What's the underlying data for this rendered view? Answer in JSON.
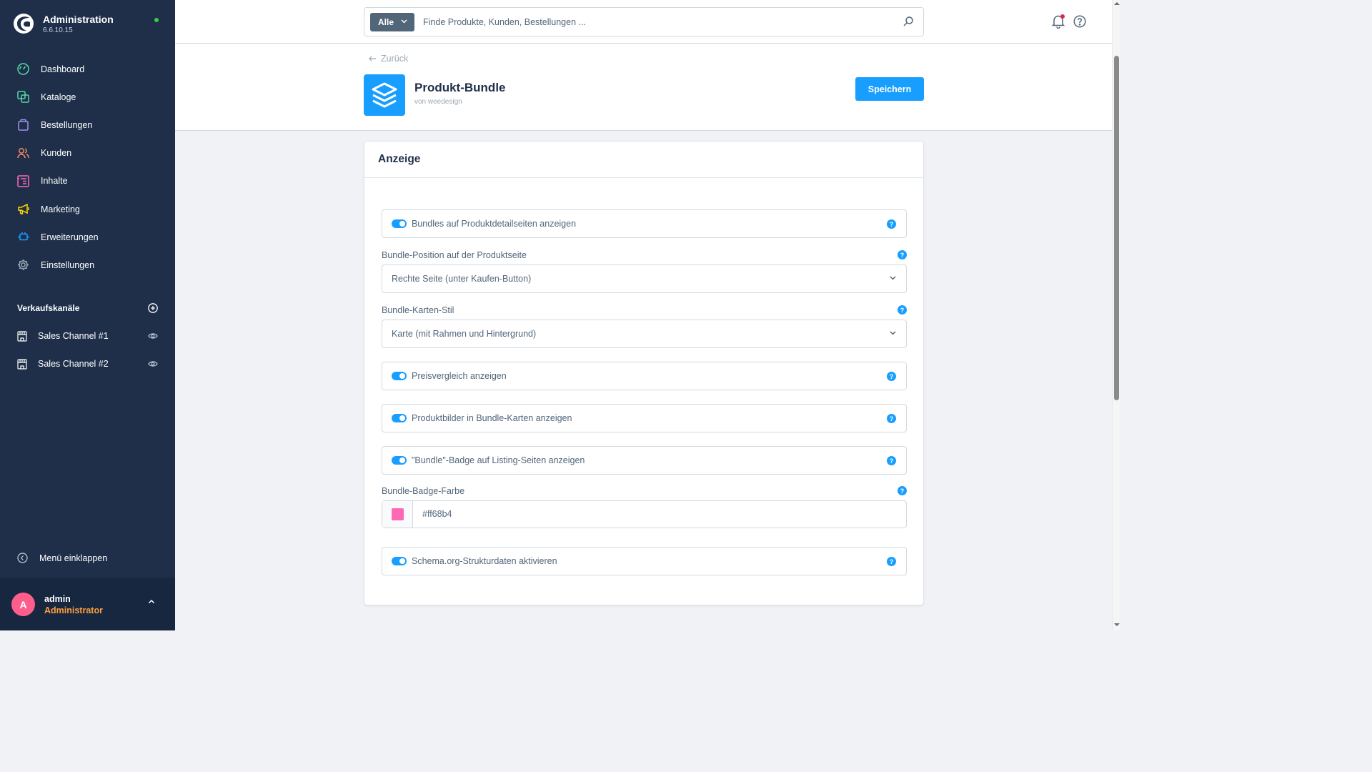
{
  "app": {
    "title": "Administration",
    "version": "6.6.10.15"
  },
  "sidebar": {
    "items": [
      {
        "label": "Dashboard",
        "icon": "dashboard-icon",
        "color": "#57d9a3"
      },
      {
        "label": "Kataloge",
        "icon": "catalog-icon",
        "color": "#57d9a3"
      },
      {
        "label": "Bestellungen",
        "icon": "bag-icon",
        "color": "#a092f0"
      },
      {
        "label": "Kunden",
        "icon": "users-icon",
        "color": "#f88962"
      },
      {
        "label": "Inhalte",
        "icon": "content-icon",
        "color": "#ff68b4"
      },
      {
        "label": "Marketing",
        "icon": "megaphone-icon",
        "color": "#ffd700"
      },
      {
        "label": "Erweiterungen",
        "icon": "plugin-icon",
        "color": "#189eff"
      },
      {
        "label": "Einstellungen",
        "icon": "gear-icon",
        "color": "#9aa8b5"
      }
    ],
    "channels_title": "Verkaufskanäle",
    "channels": [
      {
        "label": "Sales Channel #1"
      },
      {
        "label": "Sales Channel #2"
      }
    ],
    "collapse_label": "Menü einklappen"
  },
  "user": {
    "initial": "A",
    "name": "admin",
    "role": "Administrator"
  },
  "search": {
    "type": "Alle",
    "placeholder": "Finde Produkte, Kunden, Bestellungen ..."
  },
  "header": {
    "back_label": "Zurück",
    "plugin_title": "Produkt-Bundle",
    "plugin_author": "von weedesign",
    "save_label": "Speichern"
  },
  "card": {
    "title": "Anzeige",
    "toggles": {
      "pdp": {
        "label": "Bundles auf Produktdetailseiten anzeigen",
        "enabled": true
      },
      "price_compare": {
        "label": "Preisvergleich anzeigen",
        "enabled": true
      },
      "images": {
        "label": "Produktbilder in Bundle-Karten anzeigen",
        "enabled": true
      },
      "badge": {
        "label": "\"Bundle\"-Badge auf Listing-Seiten anzeigen",
        "enabled": true
      },
      "schema": {
        "label": "Schema.org-Strukturdaten aktivieren",
        "enabled": true
      }
    },
    "position": {
      "label": "Bundle-Position auf der Produktseite",
      "value": "Rechte Seite (unter Kaufen-Button)"
    },
    "card_style": {
      "label": "Bundle-Karten-Stil",
      "value": "Karte (mit Rahmen und Hintergrund)"
    },
    "badge_color": {
      "label": "Bundle-Badge-Farbe",
      "value": "#ff68b4"
    },
    "help_glyph": "?"
  },
  "colors": {
    "sidebar_bg": "#1f2f4a",
    "accent": "#189eff",
    "avatar": "#ff5e8c",
    "role": "#ff9e3d"
  }
}
